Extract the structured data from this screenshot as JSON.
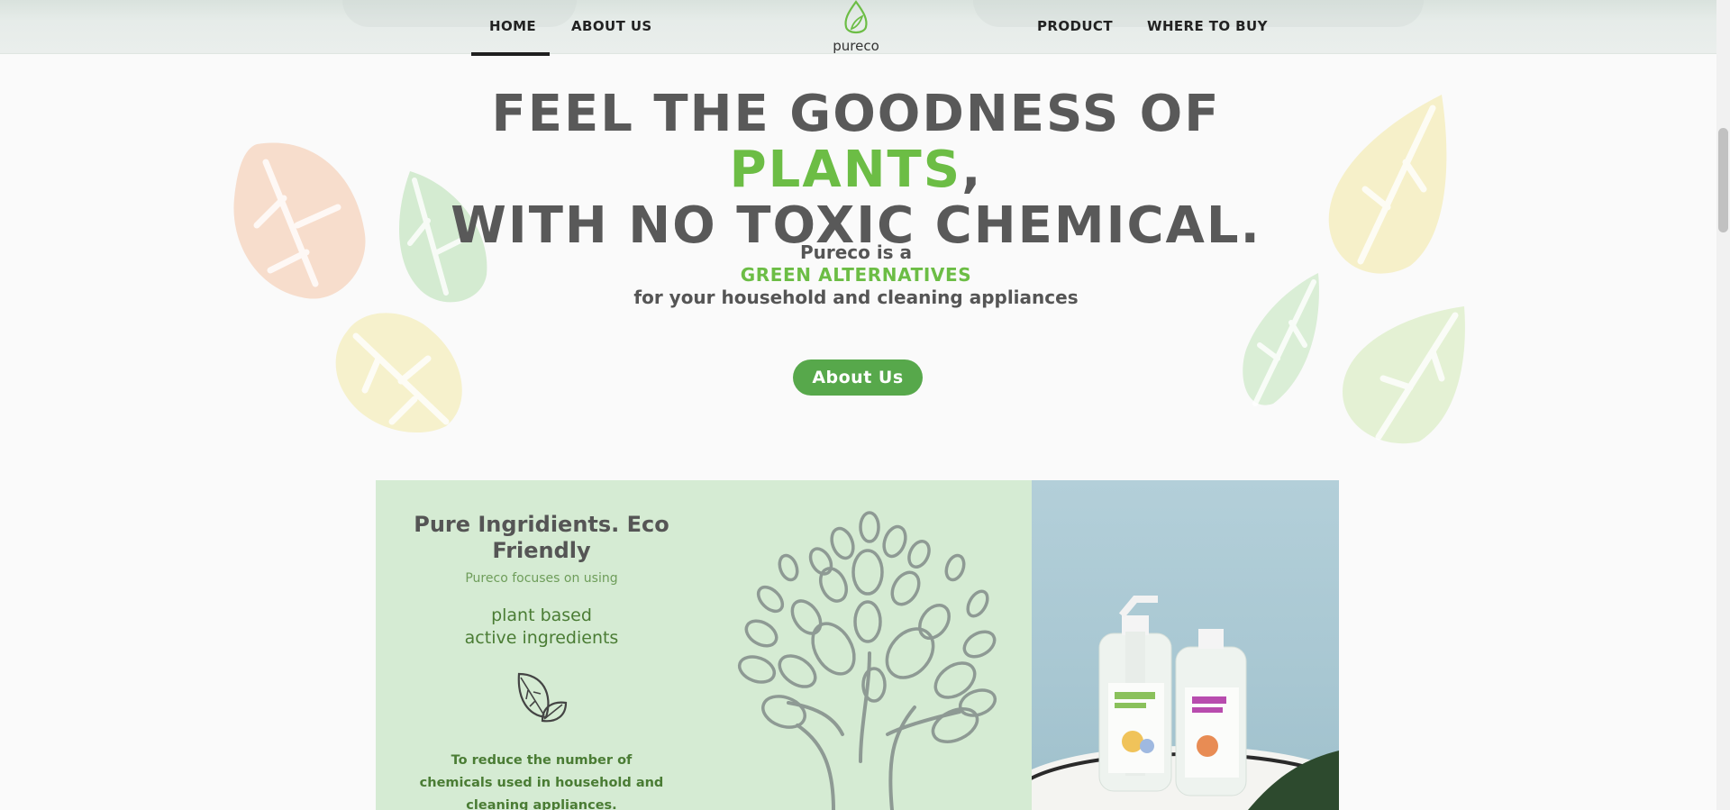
{
  "nav": {
    "links": [
      {
        "label": "HOME",
        "active": true
      },
      {
        "label": "ABOUT US",
        "active": false
      },
      {
        "label": "PRODUCT",
        "active": false
      },
      {
        "label": "WHERE TO BUY",
        "active": false
      }
    ],
    "logo_text": "pureco"
  },
  "hero": {
    "title_part1": "FEEL THE GOODNESS OF ",
    "title_highlight": "PLANTS",
    "title_part2": ",",
    "title_line2": "WITH NO TOXIC CHEMICAL.",
    "intro_line1": "Pureco is a",
    "intro_highlight": "GREEN ALTERNATIVES",
    "intro_line3": "for your household and cleaning appliances",
    "button_label": "About Us"
  },
  "feature": {
    "heading": "Pure Ingridients. Eco Friendly",
    "subtext": "Pureco focuses on using",
    "bold_line1": "plant based",
    "bold_line2": "active ingredients",
    "body": "To reduce the number of chemicals used in household and cleaning appliances."
  },
  "colors": {
    "accent_green": "#6cbd45",
    "button_green": "#57a84b",
    "panel_green": "#d5ebd3",
    "text_dark": "#555555"
  },
  "icons": [
    "pureco-leaf-logo-icon",
    "leaves-icon",
    "tree-illustration"
  ]
}
